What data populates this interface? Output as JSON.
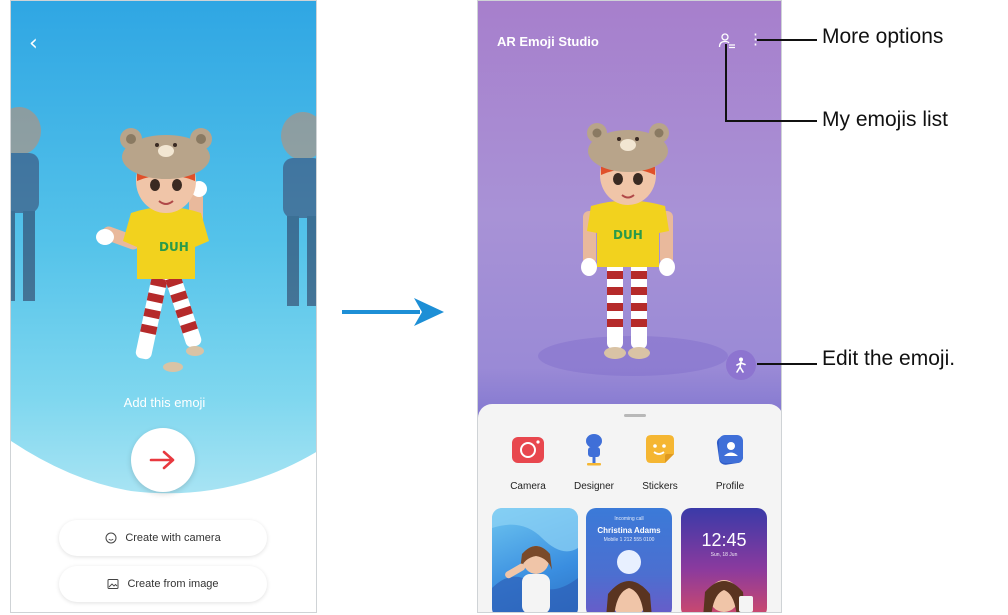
{
  "left_screen": {
    "back_icon": "chevron-left-icon",
    "prompt_text": "Add this emoji",
    "next_icon": "arrow-right-icon",
    "next_color": "#e8393f",
    "create_with_camera": "Create with camera",
    "create_from_image": "Create from image"
  },
  "right_screen": {
    "app_title": "AR Emoji Studio",
    "my_emojis_icon": "person-list-icon",
    "more_options_icon": "more-vertical-icon",
    "edit_icon": "person-walk-icon",
    "features": [
      {
        "label": "Camera",
        "icon": "camera-icon",
        "color": "#e8474e"
      },
      {
        "label": "Designer",
        "icon": "mannequin-icon",
        "color": "#3f6fd8"
      },
      {
        "label": "Stickers",
        "icon": "sticker-icon",
        "color": "#f5b632"
      },
      {
        "label": "Profile",
        "icon": "profile-card-icon",
        "color": "#3f6fd8"
      }
    ],
    "thumbnails": [
      {
        "kind": "sticker-preview"
      },
      {
        "kind": "call-screen-preview",
        "caption_top": "Incoming call",
        "name": "Christina Adams",
        "caption_sub": "Mobile 1 212 555 0100"
      },
      {
        "kind": "lock-screen-preview",
        "time": "12:45",
        "date": "Sun, 18 Jun"
      }
    ]
  },
  "callouts": {
    "more_options": "More options",
    "my_emojis_list": "My emojis list",
    "edit_emoji": "Edit the emoji."
  }
}
